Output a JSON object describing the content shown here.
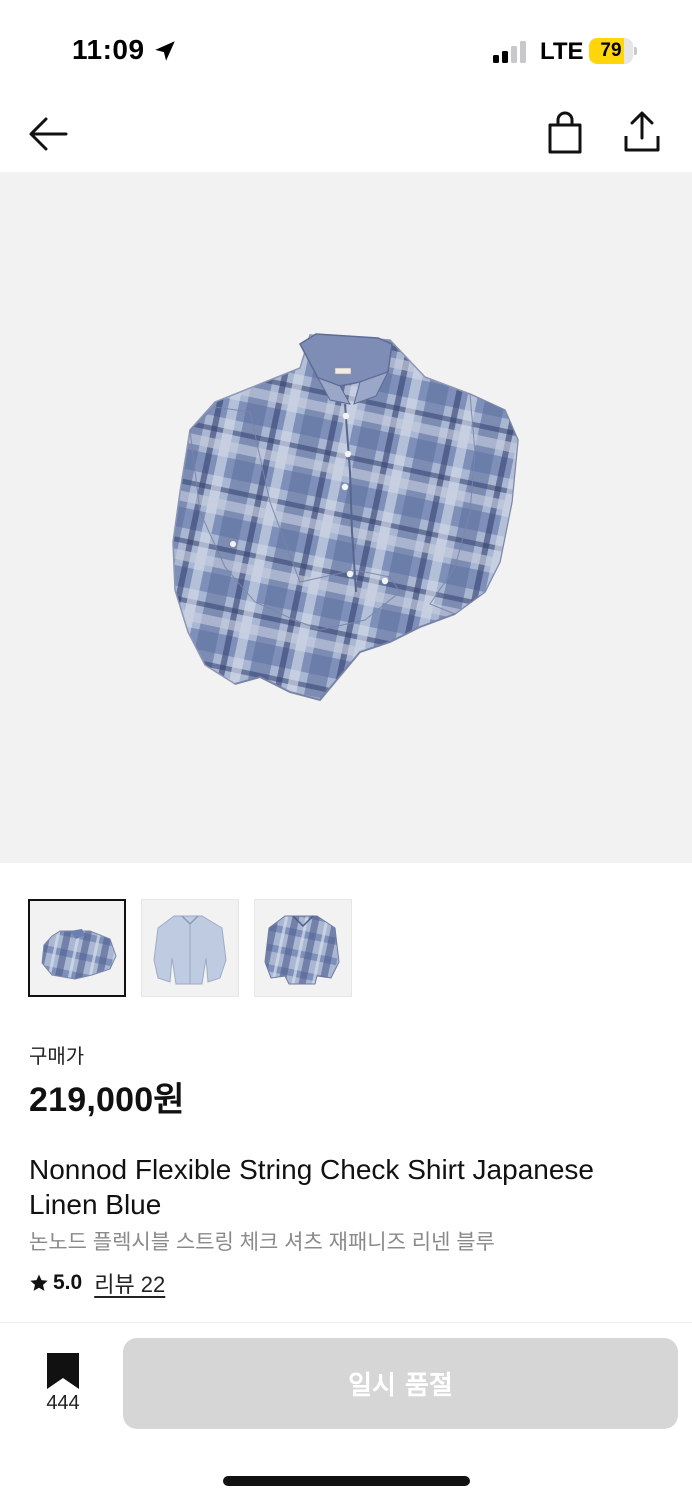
{
  "status_bar": {
    "time": "11:09",
    "network": "LTE",
    "battery": "79",
    "battery_level": 0.79
  },
  "nav": {
    "back_icon": "arrow-left-icon",
    "bag_icon": "shopping-bag-icon",
    "share_icon": "share-icon"
  },
  "gallery": {
    "thumbnail_count": 3,
    "selected_index": 0
  },
  "product": {
    "price_label": "구매가",
    "price": "219,000원",
    "name_en": "Nonnod Flexible String Check Shirt Japanese Linen Blue",
    "name_ko": "논노드 플렉시블 스트링 체크 셔츠 재패니즈 리넨 블루",
    "rating": "5.0",
    "reviews": "리뷰 22"
  },
  "bottom_bar": {
    "bookmark_count": "444",
    "action_label": "일시 품절"
  },
  "colors": {
    "button_disabled": "#d6d6d6",
    "hero_background": "#f2f2f2",
    "battery_accent": "#ffd60a"
  }
}
